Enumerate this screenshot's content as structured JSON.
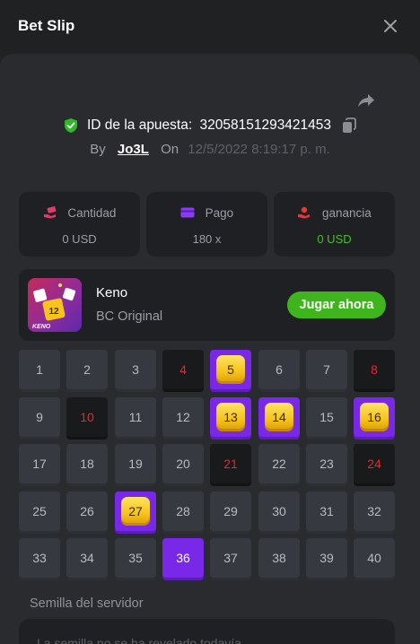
{
  "header": {
    "title": "Bet Slip"
  },
  "bet": {
    "id_label": "ID de la apuesta:",
    "id_value": "32058151293421453",
    "by_label": "By",
    "user": "Jo3L",
    "on_label": "On",
    "date": "12/5/2022 8:19:17 p. m."
  },
  "stats": [
    {
      "label": "Cantidad",
      "value": "0 USD",
      "icon": "money-hand-icon",
      "color": "#e23a6b"
    },
    {
      "label": "Pago",
      "value": "180 x",
      "icon": "wallet-icon",
      "color": "#8b3cf0"
    },
    {
      "label": "ganancia",
      "value": "0 USD",
      "icon": "profit-hand-icon",
      "color": "#e23a3a",
      "value_color": "#43c11e"
    }
  ],
  "game": {
    "name": "Keno",
    "subtitle": "BC Original",
    "play_label": "Jugar ahora",
    "thumb_label": "KENO",
    "thumb_ball": "12"
  },
  "keno": {
    "numbers": [
      "1",
      "2",
      "3",
      "4",
      "5",
      "6",
      "7",
      "8",
      "9",
      "10",
      "11",
      "12",
      "13",
      "14",
      "15",
      "16",
      "17",
      "18",
      "19",
      "20",
      "21",
      "22",
      "23",
      "24",
      "25",
      "26",
      "27",
      "28",
      "29",
      "30",
      "31",
      "32",
      "33",
      "34",
      "35",
      "36",
      "37",
      "38",
      "39",
      "40"
    ],
    "states": [
      "n",
      "n",
      "n",
      "miss",
      "hit",
      "n",
      "n",
      "miss",
      "n",
      "miss",
      "n",
      "n",
      "hit",
      "hit",
      "n",
      "hit",
      "n",
      "n",
      "n",
      "n",
      "miss",
      "n",
      "n",
      "miss",
      "n",
      "n",
      "hit",
      "n",
      "n",
      "n",
      "n",
      "n",
      "n",
      "n",
      "n",
      "pick",
      "n",
      "n",
      "n",
      "n"
    ]
  },
  "seed": {
    "label": "Semilla del servidor",
    "value": "La semilla no se ha revelado todavía"
  },
  "colors": {
    "background": "#1f2123",
    "panel": "#292b2f",
    "accent_green": "#3fb51d",
    "accent_purple": "#7a28e8",
    "miss_red": "#e8262d"
  }
}
